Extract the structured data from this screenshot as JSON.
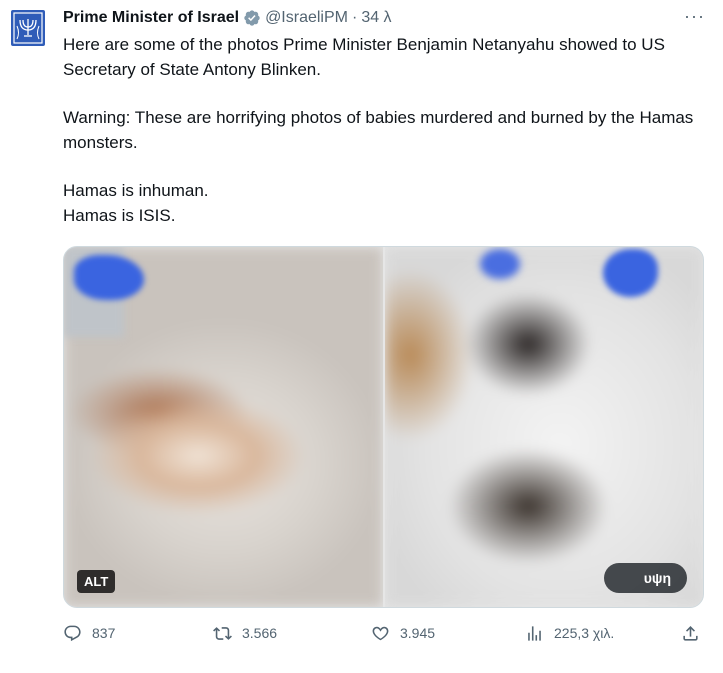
{
  "tweet": {
    "display_name": "Prime Minister of Israel",
    "handle": "@IsraeliPM",
    "separator": "·",
    "time": "34 λ",
    "more_label": "···",
    "paragraphs": [
      "Here are some of the photos Prime Minister Benjamin Netanyahu showed to US Secretary of State Antony Blinken.",
      "Warning: These are horrifying photos of babies murdered and burned by the Hamas monsters.",
      "Hamas is inhuman.",
      "Hamas is ISIS."
    ]
  },
  "media": {
    "alt_label": "ALT",
    "show_label": "υψη"
  },
  "actions": {
    "replies": "837",
    "retweets": "3.566",
    "likes": "3.945",
    "views": "225,3 χιλ."
  },
  "colors": {
    "verified_gold": "#e2b719",
    "secondary_text": "#536471",
    "primary_text": "#0f1419"
  }
}
